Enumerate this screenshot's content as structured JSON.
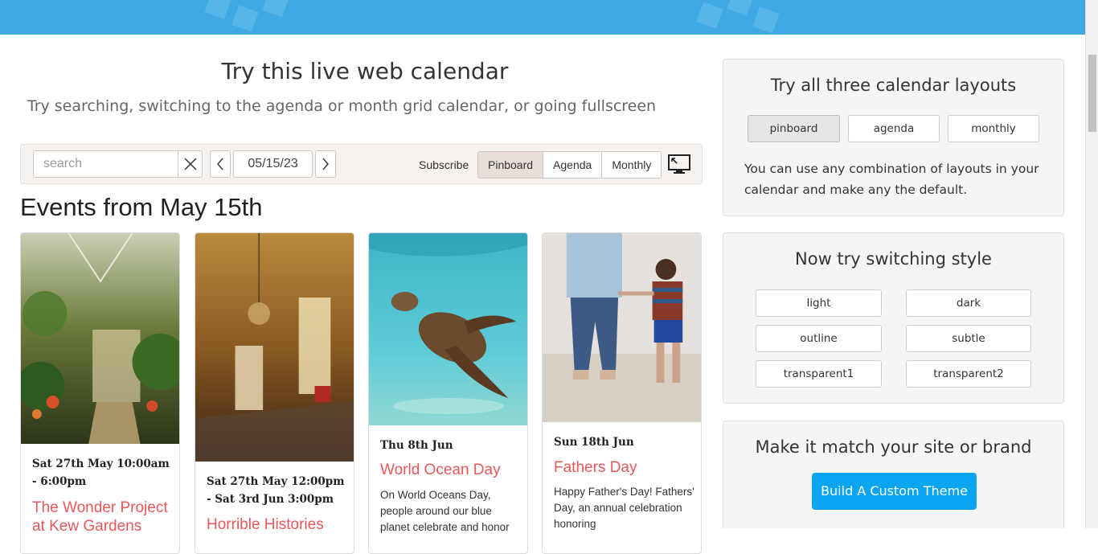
{
  "demo": {
    "title": "Try this live web calendar",
    "subtitle": "Try searching, switching to the agenda or month grid calendar, or going fullscreen"
  },
  "toolbar": {
    "search_placeholder": "search",
    "date_value": "05/15/23",
    "subscribe_label": "Subscribe",
    "views": [
      "Pinboard",
      "Agenda",
      "Monthly"
    ],
    "active_view": "Pinboard"
  },
  "events_heading": "Events from May 15th",
  "events": [
    {
      "date": "Sat 27th May 10:00am - 6:00pm",
      "title": "The Wonder Project at Kew Gardens",
      "description": ""
    },
    {
      "date": "Sat 27th May 12:00pm - Sat 3rd Jun 3:00pm",
      "title": "Horrible Histories",
      "description": ""
    },
    {
      "date": "Thu 8th Jun",
      "title": "World Ocean Day",
      "description": "On World Oceans Day, people around our blue planet celebrate and honor"
    },
    {
      "date": "Sun 18th Jun",
      "title": "Fathers Day",
      "description": "Happy Father's Day! Fathers' Day, an annual celebration honoring"
    }
  ],
  "layouts_panel": {
    "title": "Try all three calendar layouts",
    "buttons": [
      "pinboard",
      "agenda",
      "monthly"
    ],
    "active": "pinboard",
    "text": "You can use any combination of layouts in your calendar and make any the default."
  },
  "style_panel": {
    "title": "Now try switching style",
    "buttons": [
      "light",
      "dark",
      "outline",
      "subtle",
      "transparent1",
      "transparent2"
    ]
  },
  "brand_panel": {
    "title": "Make it match your site or brand",
    "button": "Build A Custom Theme"
  },
  "colors": {
    "header_blue": "#3fa9e4",
    "event_title": "#e8585a",
    "cta_blue": "#0aa5f0"
  }
}
